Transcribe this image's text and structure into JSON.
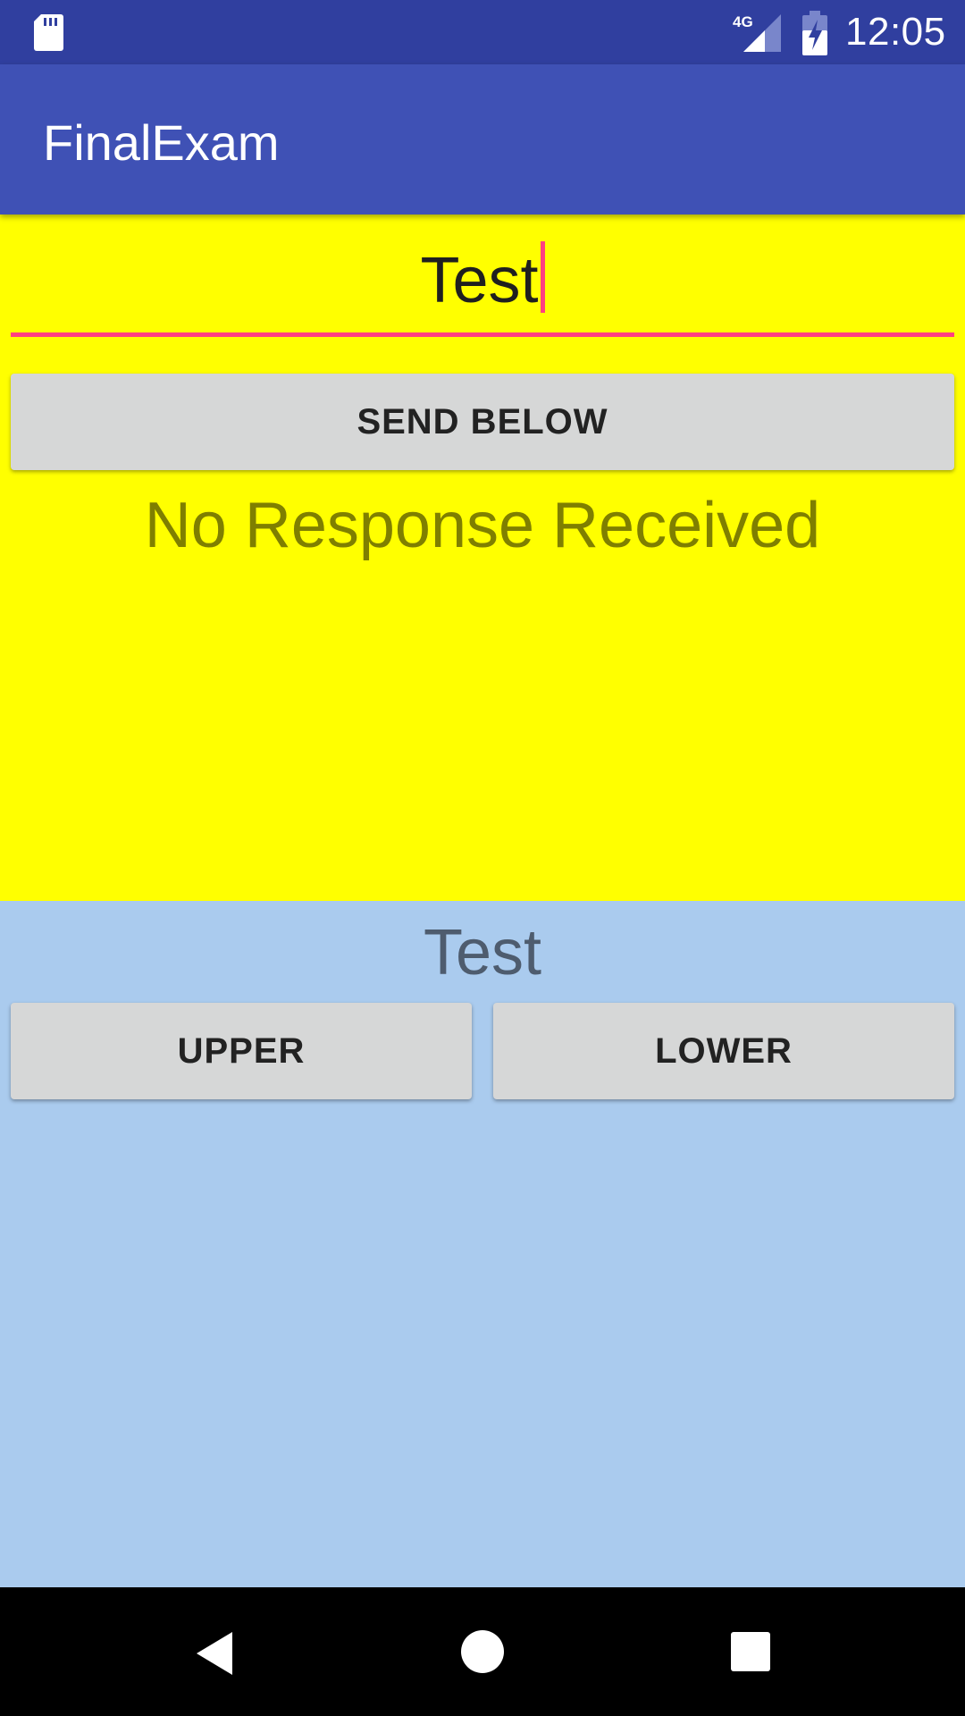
{
  "status_bar": {
    "time": "12:05",
    "network_label": "4G",
    "icons": [
      "sd-card-icon",
      "signal-4g-icon",
      "battery-charging-icon"
    ]
  },
  "app_bar": {
    "title": "FinalExam"
  },
  "top_panel": {
    "input_value": "Test",
    "send_button_label": "SEND BELOW",
    "response_text": "No Response Received"
  },
  "bottom_panel": {
    "received_text": "Test",
    "upper_button_label": "UPPER",
    "lower_button_label": "LOWER"
  },
  "nav_bar": {
    "icons": [
      "back-icon",
      "home-icon",
      "recent-apps-icon"
    ]
  },
  "colors": {
    "status_bar": "#303F9F",
    "app_bar": "#3F51B5",
    "accent": "#FF4081",
    "top_panel": "#FFFF00",
    "bottom_panel": "#AACBEE",
    "button": "#D6D7D7"
  }
}
